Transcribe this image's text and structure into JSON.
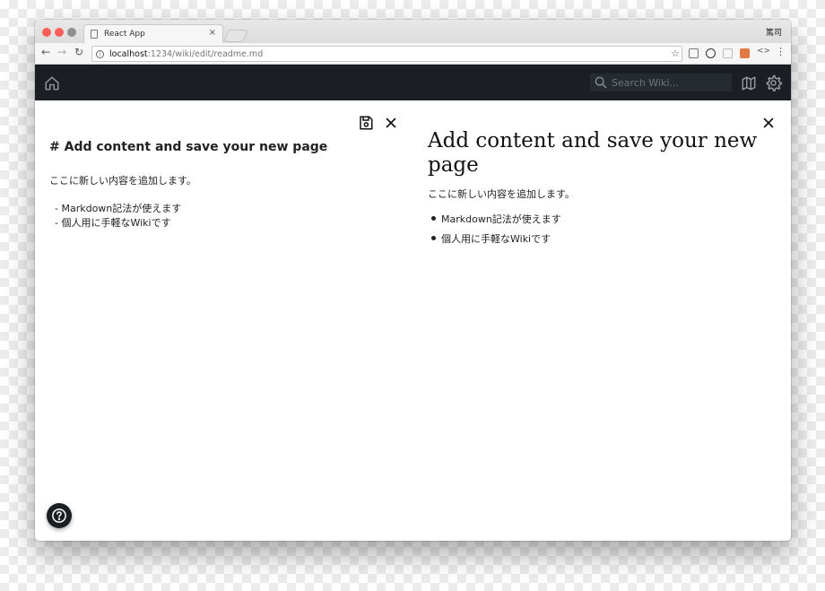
{
  "browser": {
    "tab_title": "React App",
    "tab_close": "×",
    "profile_name": "篤司",
    "url_host": "localhost",
    "url_path": ":1234/wiki/edit/readme.md",
    "star": "☆",
    "menu": "⋮",
    "dev": "<>",
    "back": "←",
    "forward": "→",
    "reload": "↻"
  },
  "appbar": {
    "search_placeholder": "Search Wiki...",
    "bg_color": "#1b1f23"
  },
  "editor": {
    "heading": "# Add content and save your new page",
    "paragraph": "ここに新しい内容を追加します。",
    "list_items": [
      "- Markdown記法が使えます",
      "- 個人用に手軽なWikiです"
    ]
  },
  "preview": {
    "heading": "Add content and save your new page",
    "paragraph": "ここに新しい内容を追加します。",
    "list_items": [
      "Markdown記法が使えます",
      "個人用に手軽なWikiです"
    ]
  },
  "icons": {
    "home": "home-icon",
    "search": "search-icon",
    "map": "map-icon",
    "settings": "gear-icon",
    "save": "save-icon",
    "close": "close-icon",
    "help": "help-icon"
  }
}
